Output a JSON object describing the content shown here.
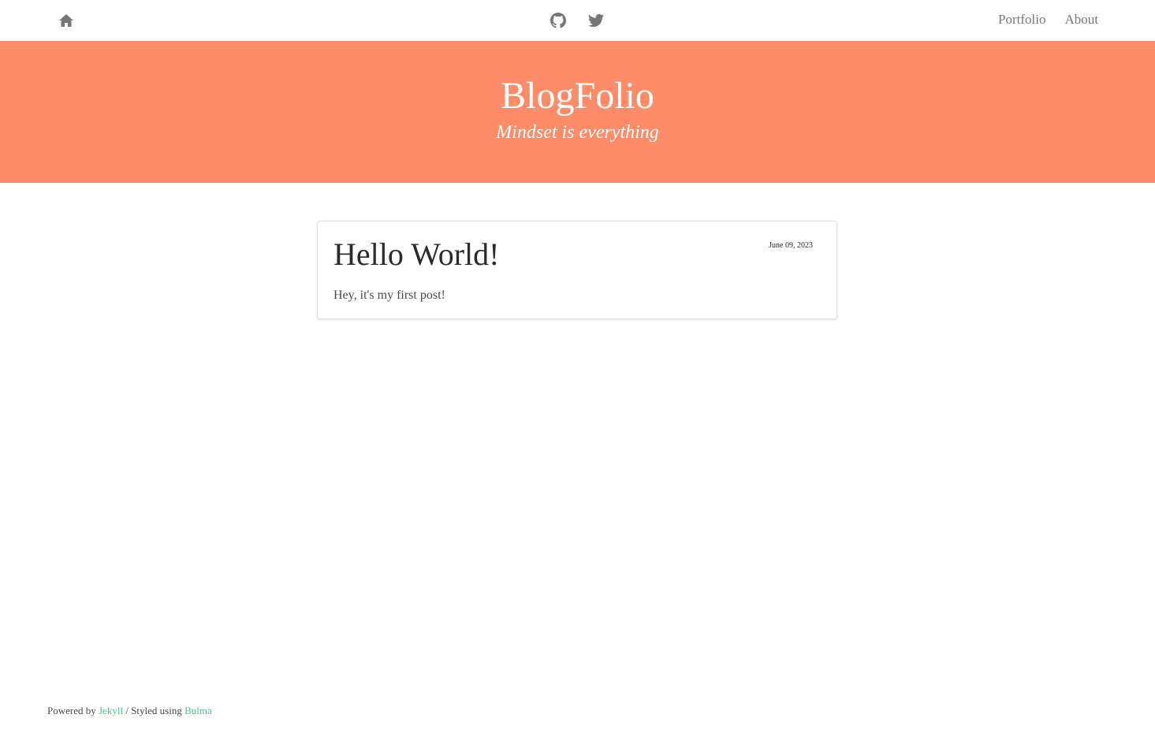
{
  "colors": {
    "hero_background": "#ff8c69",
    "link_accent": "#4fc08d",
    "nav_icon": "#777777"
  },
  "navbar": {
    "home_icon": "home-icon",
    "social_icons": [
      "github-icon",
      "twitter-icon"
    ],
    "links": {
      "portfolio": "Portfolio",
      "about": "About"
    }
  },
  "hero": {
    "title": "BlogFolio",
    "subtitle": "Mindset is everything"
  },
  "posts": [
    {
      "title": "Hello World!",
      "date": "June 09, 2023",
      "excerpt": "Hey, it's my first post!"
    }
  ],
  "footer": {
    "powered_by": "Powered by ",
    "jekyll": "Jekyll",
    "separator": " / Styled using ",
    "bulma": "Bulma"
  }
}
